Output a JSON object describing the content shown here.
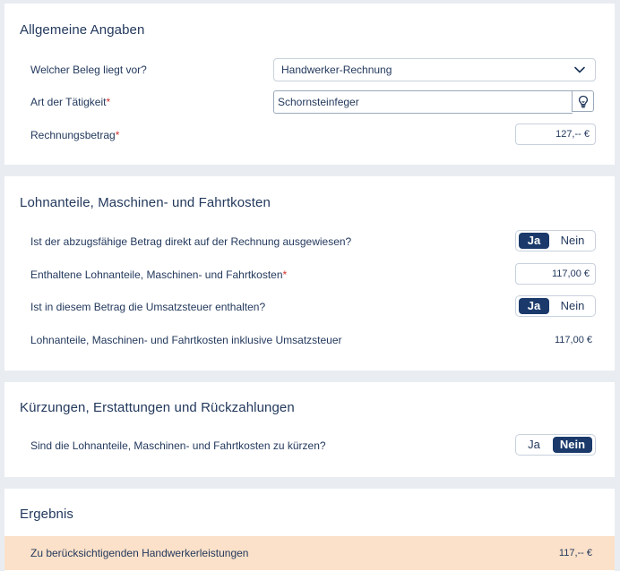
{
  "sections": {
    "general": {
      "title": "Allgemeine Angaben",
      "beleg_label": "Welcher Beleg liegt vor?",
      "beleg_value": "Handwerker-Rechnung",
      "taetigkeit_label": "Art der Tätigkeit",
      "taetigkeit_value": "Schornsteinfeger",
      "betrag_label": "Rechnungsbetrag",
      "betrag_value": "127,-- €",
      "required_mark": "*"
    },
    "lohn": {
      "title": "Lohnanteile, Maschinen- und Fahrtkosten",
      "direct_label": "Ist der abzugsfähige Betrag direkt auf der Rechnung ausgewiesen?",
      "direct_selected": "Ja",
      "enthaltene_label": "Enthaltene Lohnanteile, Maschinen- und Fahrtkosten",
      "enthaltene_value": "117,00 €",
      "ust_label": "Ist in diesem Betrag die Umsatzsteuer enthalten?",
      "ust_selected": "Ja",
      "inkl_label": "Lohnanteile, Maschinen- und Fahrtkosten inklusive Umsatzsteuer",
      "inkl_value": "117,00 €"
    },
    "kuerzungen": {
      "title": "Kürzungen, Erstattungen und Rückzahlungen",
      "kuerzen_label": "Sind die Lohnanteile, Maschinen- und Fahrtkosten zu kürzen?",
      "kuerzen_selected": "Nein"
    },
    "ergebnis": {
      "title": "Ergebnis",
      "result_label": "Zu berücksichtigenden Handwerkerleistungen",
      "result_value": "117,-- €"
    }
  },
  "toggle": {
    "yes": "Ja",
    "no": "Nein"
  },
  "icons": {
    "select_chevron": "chevron-down-icon",
    "hint_button": "lightbulb-icon"
  },
  "colors": {
    "accent": "#1b3a6b",
    "required": "#d0342c",
    "result_background": "#fbe1c9",
    "page_background": "#e9edf2"
  }
}
